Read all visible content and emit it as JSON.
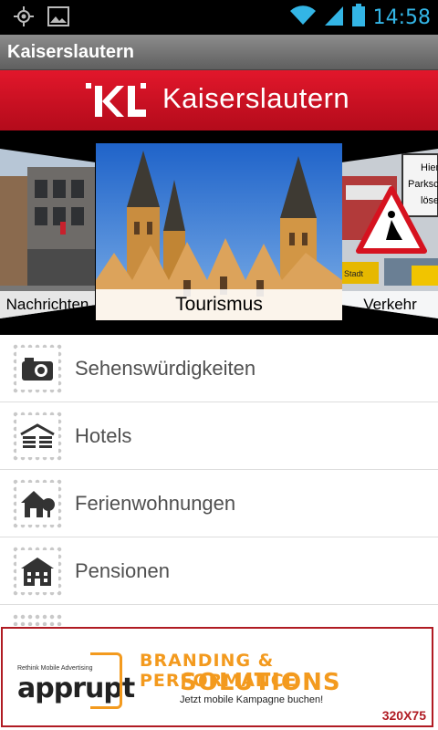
{
  "status_bar": {
    "time": "14:58",
    "icons": [
      "gps-icon",
      "image-icon",
      "wifi-icon",
      "signal-icon",
      "battery-icon"
    ]
  },
  "app": {
    "title": "Kaiserslautern"
  },
  "banner": {
    "logo_text": "KL",
    "city_name": "Kaiserslautern",
    "color": "#d5121f"
  },
  "carousel": {
    "left_caption": "Nachrichten",
    "center_caption": "Tourismus",
    "right_caption": "Verkehr",
    "right_sign_text": [
      "Hier",
      "Parksch",
      "löse"
    ],
    "right_small_sign": "Stadt"
  },
  "list": {
    "items": [
      {
        "label": "Sehenswürdigkeiten",
        "icon": "camera-icon"
      },
      {
        "label": "Hotels",
        "icon": "hotel-icon"
      },
      {
        "label": "Ferienwohnungen",
        "icon": "house-tree-icon"
      },
      {
        "label": "Pensionen",
        "icon": "building-icon"
      },
      {
        "label": "",
        "icon": ""
      }
    ]
  },
  "ad": {
    "small_text": "Rethink Mobile Advertising",
    "brand": "apprupt",
    "headline1": "BRANDING & PERFORMANCE",
    "headline2": "SOLUTIONS",
    "subline": "Jetzt mobile Kampagne buchen!",
    "size_label": "320X75",
    "accent_color": "#f39a1e",
    "border_color": "#b01b23"
  }
}
